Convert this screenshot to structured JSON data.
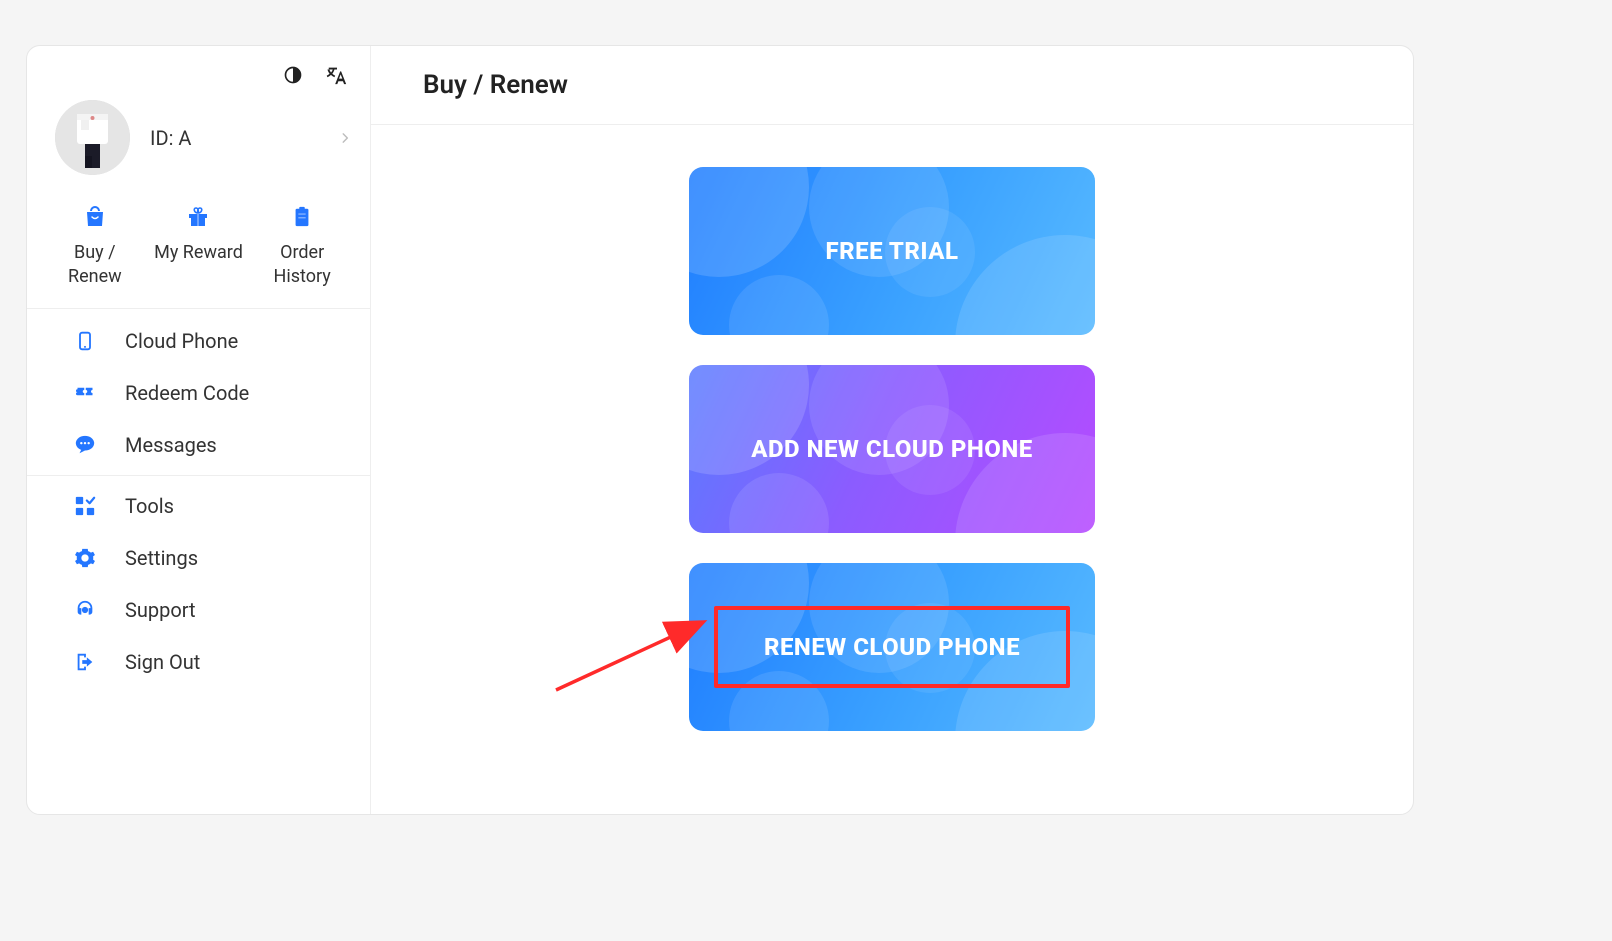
{
  "header": {
    "title": "Buy / Renew"
  },
  "profile": {
    "id_label": "ID: A"
  },
  "quick": {
    "buy_renew": "Buy / Renew",
    "my_reward": "My Reward",
    "order_history": "Order History"
  },
  "menu": {
    "cloud_phone": "Cloud Phone",
    "redeem_code": "Redeem Code",
    "messages": "Messages",
    "tools": "Tools",
    "settings": "Settings",
    "support": "Support",
    "sign_out": "Sign Out"
  },
  "cards": {
    "free_trial": "FREE TRIAL",
    "add_new": "ADD NEW CLOUD PHONE",
    "renew": "RENEW CLOUD PHONE"
  }
}
